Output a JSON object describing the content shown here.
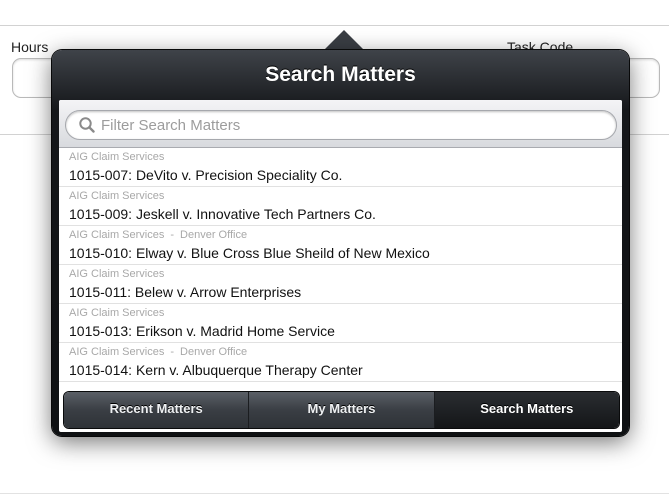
{
  "background_form": {
    "hours_label": "Hours",
    "task_code_label": "Task Code"
  },
  "popover": {
    "title": "Search Matters",
    "search": {
      "placeholder": "Filter Search Matters",
      "icon": "search-icon"
    },
    "matters": [
      {
        "client": "AIG Claim Services",
        "office": "",
        "title": "1015-007: DeVito v. Precision Speciality Co."
      },
      {
        "client": "AIG Claim Services",
        "office": "",
        "title": "1015-009: Jeskell v. Innovative Tech Partners Co."
      },
      {
        "client": "AIG Claim Services",
        "office": "Denver Office",
        "title": "1015-010: Elway v. Blue Cross Blue Sheild of New Mexico"
      },
      {
        "client": "AIG Claim Services",
        "office": "",
        "title": "1015-011: Belew v. Arrow Enterprises"
      },
      {
        "client": "AIG Claim Services",
        "office": "",
        "title": "1015-013: Erikson v. Madrid Home Service"
      },
      {
        "client": "AIG Claim Services",
        "office": "Denver Office",
        "title": "1015-014: Kern v. Albuquerque Therapy Center"
      }
    ],
    "tabs": [
      {
        "label": "Recent Matters",
        "active": false
      },
      {
        "label": "My Matters",
        "active": false
      },
      {
        "label": "Search Matters",
        "active": true
      }
    ]
  },
  "colors": {
    "popover_dark": "#15171a",
    "row_subtitle": "#a8a8a8",
    "row_title": "#111111"
  }
}
